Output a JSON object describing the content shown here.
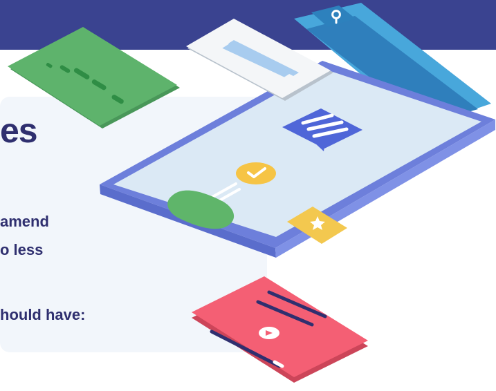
{
  "hero": {
    "heading_fragment": "es",
    "lines": [
      "amend",
      "o less",
      "hould have:"
    ]
  },
  "colors": {
    "top_band": "#3a4390",
    "card_background": "#f2f6fb",
    "heading_text": "#2f2f6f",
    "device_frame": "#7183dd",
    "device_screen": "#dbe9f5",
    "green_card": "#5eb36c",
    "red_card": "#f06075",
    "blue_panel": "#52b4e4",
    "yellow_accent": "#fad55c"
  },
  "icons": [
    "audio-bars-icon",
    "search-pin-icon",
    "chat-message-icon",
    "check-badge-icon",
    "star-badge-icon",
    "play-icon"
  ]
}
